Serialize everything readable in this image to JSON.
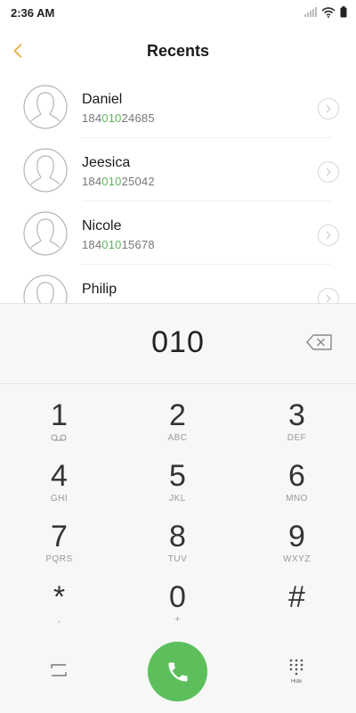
{
  "status": {
    "time": "2:36 AM"
  },
  "header": {
    "title": "Recents"
  },
  "contacts": [
    {
      "name": "Daniel",
      "number_prefix": "184",
      "number_match": "010",
      "number_suffix": "24685"
    },
    {
      "name": "Jeesica",
      "number_prefix": "184",
      "number_match": "010",
      "number_suffix": "25042"
    },
    {
      "name": "Nicole",
      "number_prefix": "184",
      "number_match": "010",
      "number_suffix": "15678"
    },
    {
      "name": "Philip",
      "number_prefix": "",
      "number_match": "",
      "number_suffix": ""
    }
  ],
  "dialer": {
    "input": "010",
    "keys": [
      {
        "digit": "1",
        "letters": ""
      },
      {
        "digit": "2",
        "letters": "ABC"
      },
      {
        "digit": "3",
        "letters": "DEF"
      },
      {
        "digit": "4",
        "letters": "GHI"
      },
      {
        "digit": "5",
        "letters": "JKL"
      },
      {
        "digit": "6",
        "letters": "MNO"
      },
      {
        "digit": "7",
        "letters": "PQRS"
      },
      {
        "digit": "8",
        "letters": "TUV"
      },
      {
        "digit": "9",
        "letters": "WXYZ"
      },
      {
        "digit": "*",
        "letters": ","
      },
      {
        "digit": "0",
        "letters": "+"
      },
      {
        "digit": "#",
        "letters": ""
      }
    ],
    "hide_label": "Hide"
  },
  "colors": {
    "accent": "#e8a93a",
    "call": "#5cbf5c",
    "match": "#5cb85c"
  },
  "icons": [
    "back-icon",
    "voicemail-icon",
    "backspace-icon",
    "phone-icon",
    "swap-icon",
    "dialpad-icon"
  ]
}
